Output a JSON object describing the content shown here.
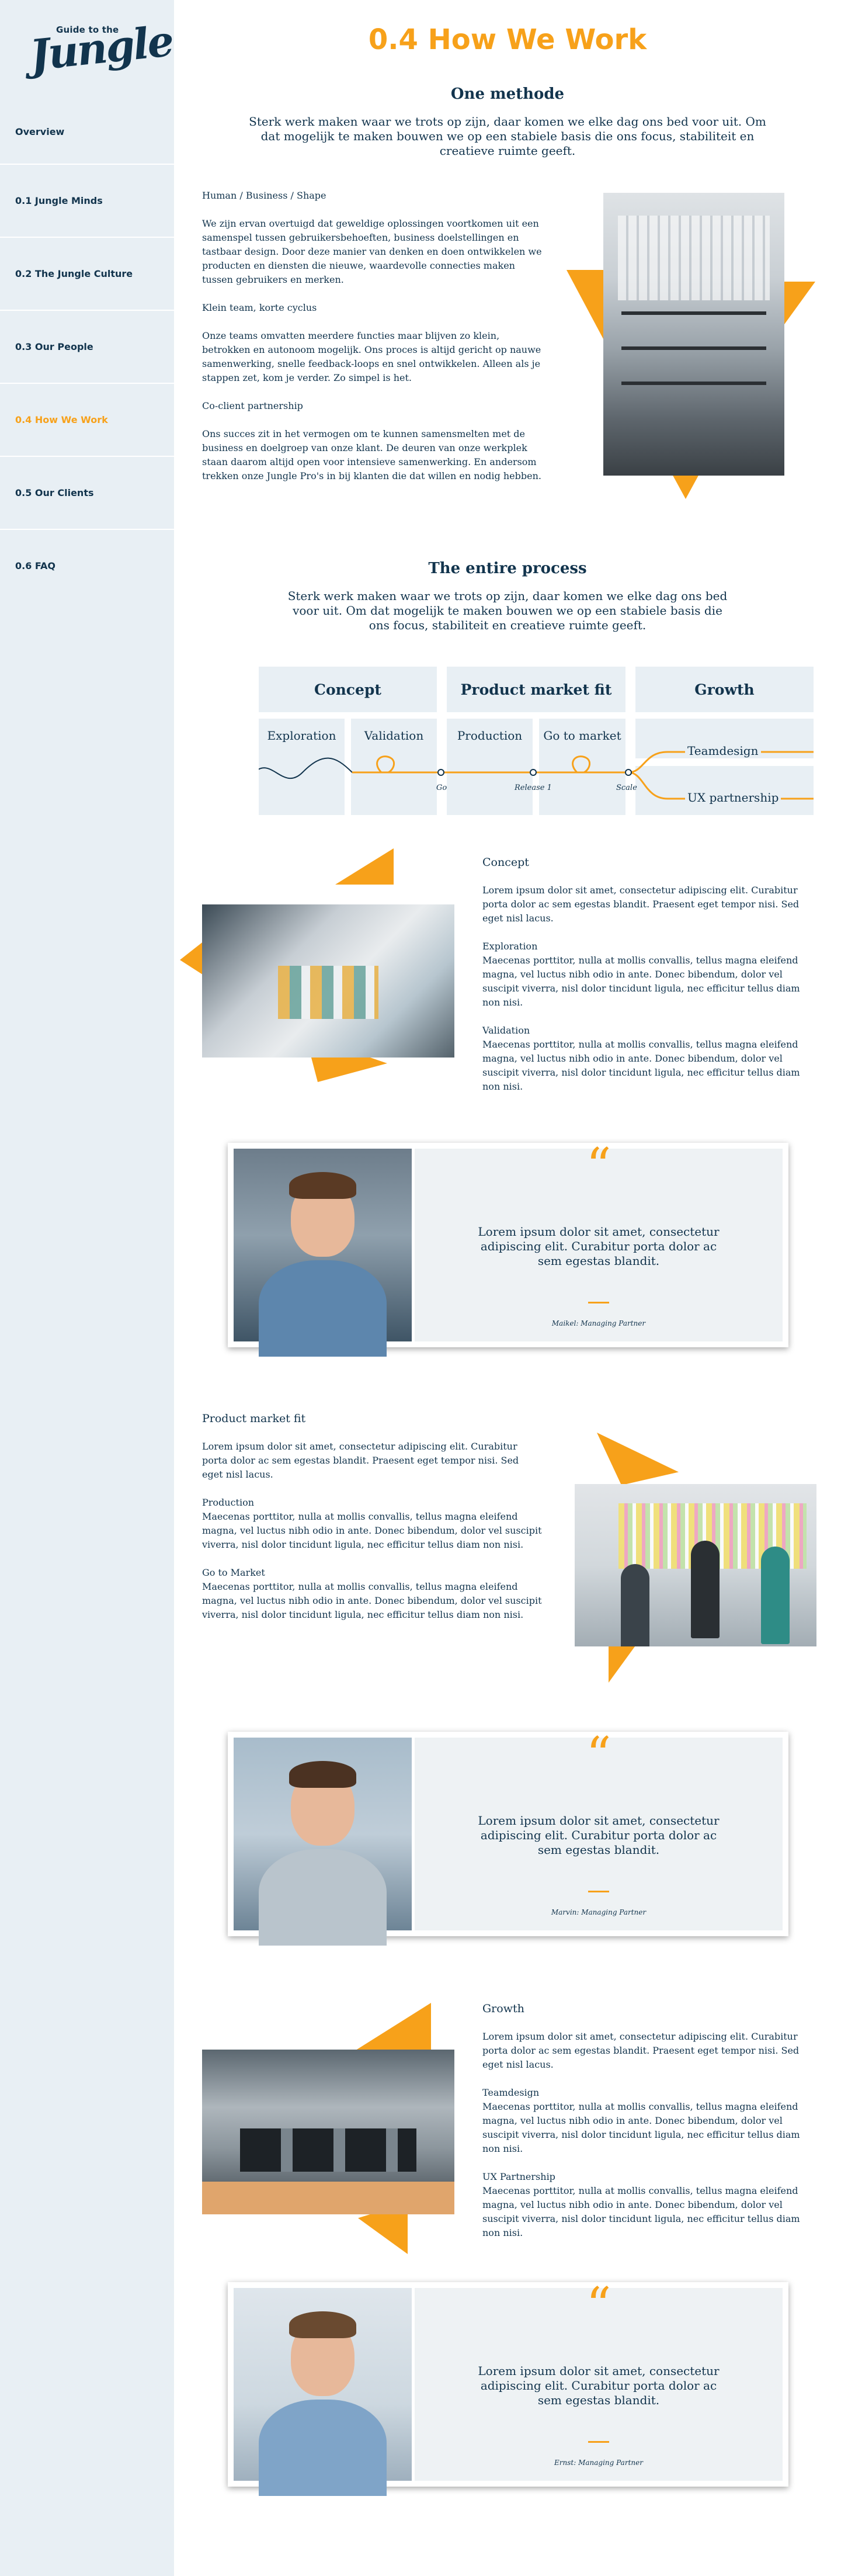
{
  "logo": {
    "top": "Guide to the",
    "main": "Jungle"
  },
  "nav": [
    {
      "label": "Overview",
      "active": false
    },
    {
      "label": "0.1 Jungle Minds",
      "active": false
    },
    {
      "label": "0.2 The Jungle Culture",
      "active": false
    },
    {
      "label": "0.3 Our People",
      "active": false
    },
    {
      "label": "0.4 How We Work",
      "active": true
    },
    {
      "label": "0.5 Our Clients",
      "active": false
    },
    {
      "label": "0.6 FAQ",
      "active": false
    }
  ],
  "page": {
    "title": "0.4 How We Work"
  },
  "methode": {
    "heading": "One methode",
    "lead": "Sterk werk maken waar we trots op zijn, daar komen we elke dag ons bed voor uit. Om dat mogelijk te maken bouwen we op een stabiele basis die ons focus, stabiliteit en creatieve ruimte geeft.",
    "p1_label": "Human / Business / Shape",
    "p1": "We zijn ervan overtuigd dat geweldige oplossingen voortkomen uit een samenspel tussen gebruikersbehoeften, business doelstellingen en tastbaar design. Door deze manier van denken en doen ontwikkelen we producten en diensten die nieuwe, waardevolle connecties maken tussen gebruikers en merken.",
    "p2_label": "Klein team, korte cyclus",
    "p2": "Onze teams omvatten meerdere functies maar blijven zo klein, betrokken en autonoom mogelijk. Ons proces is altijd gericht op nauwe samenwerking, snelle feedback-loops en snel ontwikkelen. Alleen als je stappen zet, kom je verder. Zo simpel is het.",
    "p3_label": "Co-client partnership",
    "p3": "Ons succes zit in het vermogen om te kunnen samensmelten met de business en doelgroep van onze klant. De deuren van onze werkplek staan daarom altijd open voor intensieve samenwerking. En andersom trekken onze Jungle Pro's in bij klanten die dat willen en nodig hebben."
  },
  "process": {
    "heading": "The entire process",
    "lead": "Sterk werk maken waar we trots op zijn, daar komen we elke dag ons bed voor uit. Om dat mogelijk te maken bouwen we op een stabiele basis die ons focus, stabiliteit en creatieve ruimte geeft.",
    "phases": [
      "Concept",
      "Product market fit",
      "Growth"
    ],
    "steps": [
      "Exploration",
      "Validation",
      "Production",
      "Go to market"
    ],
    "milestones": [
      "Go",
      "Release 1",
      "Scale"
    ],
    "branches": [
      "Teamdesign",
      "UX partnership"
    ]
  },
  "concept": {
    "title": "Concept",
    "intro": "Lorem ipsum dolor sit amet, consectetur adipiscing elit. Curabitur porta dolor ac sem egestas blandit. Praesent eget tempor nisi. Sed eget nisl lacus.",
    "s1_title": "Exploration",
    "s1": "Maecenas porttitor, nulla at mollis convallis, tellus magna eleifend magna, vel luctus nibh odio in ante. Donec bibendum, dolor vel suscipit viverra, nisl dolor tincidunt ligula, nec efficitur tellus diam non nisi.",
    "s2_title": "Validation",
    "s2": "Maecenas porttitor, nulla at mollis convallis, tellus magna eleifend magna, vel luctus nibh odio in ante. Donec bibendum, dolor vel suscipit viverra, nisl dolor tincidunt ligula, nec efficitur tellus diam non nisi."
  },
  "quote1": {
    "mark": "“",
    "text": "Lorem ipsum dolor sit amet, consectetur adipiscing elit. Curabitur porta dolor ac sem egestas blandit.",
    "author": "Maikel: Managing Partner"
  },
  "pmf": {
    "title": "Product market fit",
    "intro": "Lorem ipsum dolor sit amet, consectetur adipiscing elit. Curabitur porta dolor ac sem egestas blandit. Praesent eget tempor nisi. Sed eget nisl lacus.",
    "s1_title": "Production",
    "s1": "Maecenas porttitor, nulla at mollis convallis, tellus magna eleifend magna, vel luctus nibh odio in ante. Donec bibendum, dolor vel suscipit viverra, nisl dolor tincidunt ligula, nec efficitur tellus diam non nisi.",
    "s2_title": "Go to Market",
    "s2": "Maecenas porttitor, nulla at mollis convallis, tellus magna eleifend magna, vel luctus nibh odio in ante. Donec bibendum, dolor vel suscipit viverra, nisl dolor tincidunt ligula, nec efficitur tellus diam non nisi."
  },
  "quote2": {
    "mark": "“",
    "text": "Lorem ipsum dolor sit amet, consectetur adipiscing elit. Curabitur porta dolor ac sem egestas blandit.",
    "author": "Marvin: Managing Partner"
  },
  "growth": {
    "title": "Growth",
    "intro": "Lorem ipsum dolor sit amet, consectetur adipiscing elit. Curabitur porta dolor ac sem egestas blandit. Praesent eget tempor nisi. Sed eget nisl lacus.",
    "s1_title": "Teamdesign",
    "s1": "Maecenas porttitor, nulla at mollis convallis, tellus magna eleifend magna, vel luctus nibh odio in ante. Donec bibendum, dolor vel suscipit viverra, nisl dolor tincidunt ligula, nec efficitur tellus diam non nisi.",
    "s2_title": "UX Partnership",
    "s2": "Maecenas porttitor, nulla at mollis convallis, tellus magna eleifend magna, vel luctus nibh odio in ante. Donec bibendum, dolor vel suscipit viverra, nisl dolor tincidunt ligula, nec efficitur tellus diam non nisi."
  },
  "quote3": {
    "mark": "“",
    "text": "Lorem ipsum dolor sit amet, consectetur adipiscing elit. Curabitur porta dolor ac sem egestas blandit.",
    "author": "Ernst: Managing Partner"
  },
  "colors": {
    "accent": "#f7a11a",
    "navy": "#12344d",
    "sidebar": "#e8eff4",
    "panel": "#eef2f4"
  }
}
